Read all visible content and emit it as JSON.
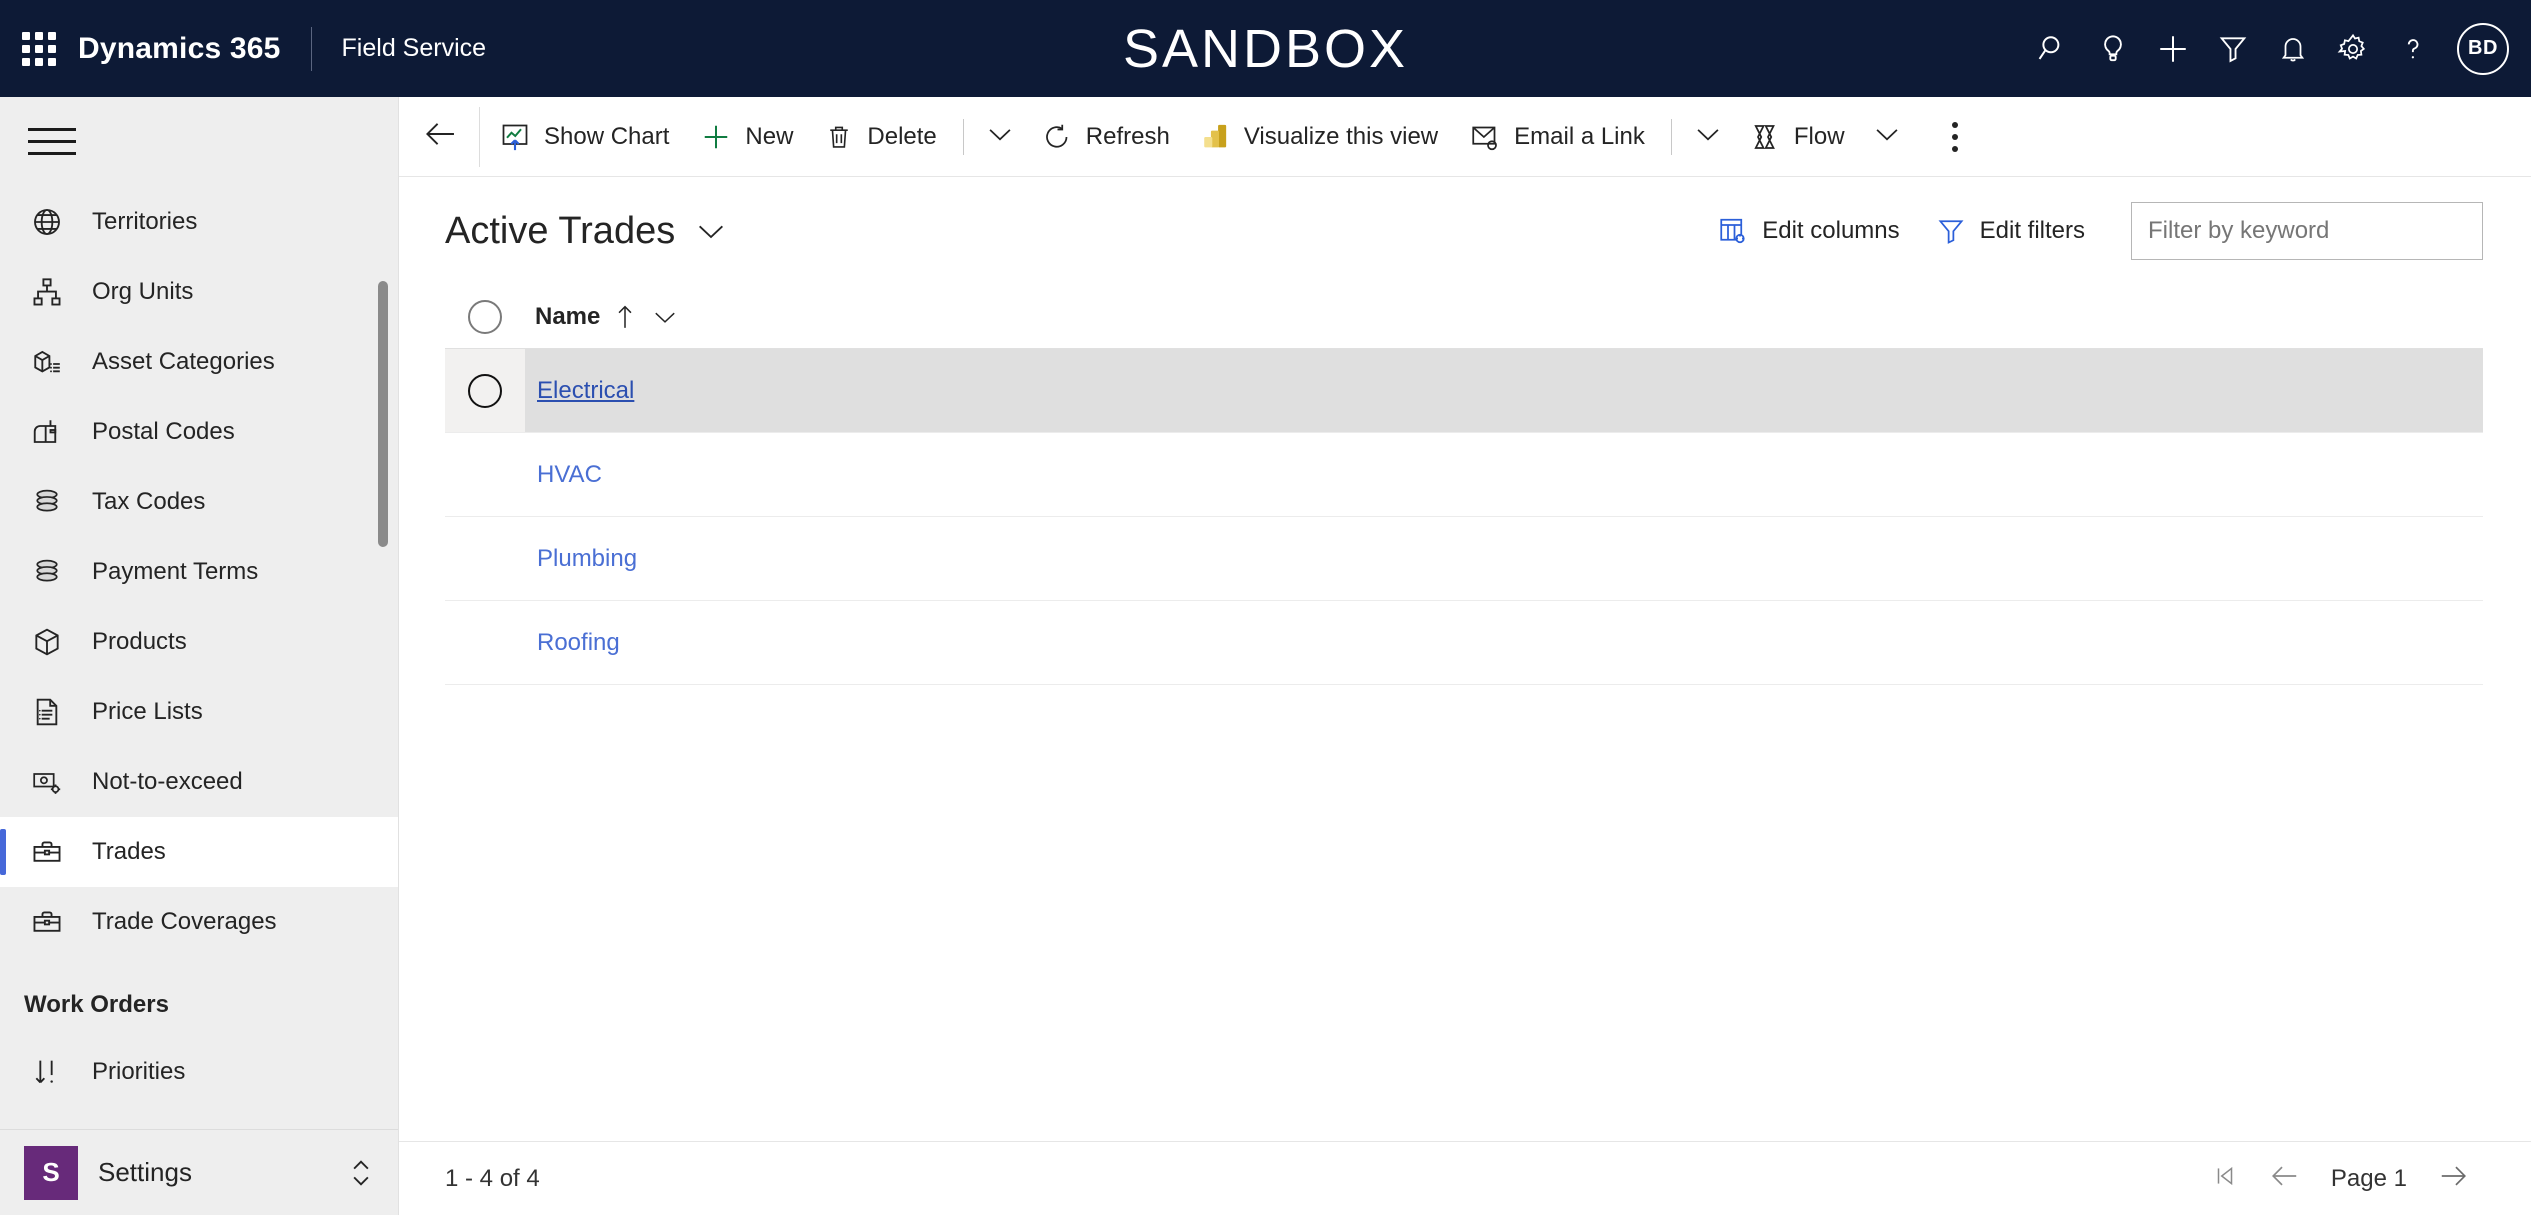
{
  "topbar": {
    "waffle_icon": "app-launcher-icon",
    "brand": "Dynamics 365",
    "app_name": "Field Service",
    "environment_banner": "SANDBOX",
    "actions": [
      {
        "name": "search-icon",
        "label": "Search"
      },
      {
        "name": "lightbulb-icon",
        "label": "Assist"
      },
      {
        "name": "plus-icon",
        "label": "Quick create"
      },
      {
        "name": "filter-icon",
        "label": "Filter"
      },
      {
        "name": "bell-icon",
        "label": "Notifications"
      },
      {
        "name": "gear-icon",
        "label": "Settings"
      },
      {
        "name": "question-icon",
        "label": "Help"
      }
    ],
    "avatar_initials": "BD"
  },
  "sidebar": {
    "hamburger_icon": "hamburger-icon",
    "items": [
      {
        "label": "Territories",
        "icon": "globe-icon",
        "selected": false
      },
      {
        "label": "Org Units",
        "icon": "org-chart-icon",
        "selected": false
      },
      {
        "label": "Asset Categories",
        "icon": "asset-box-icon",
        "selected": false
      },
      {
        "label": "Postal Codes",
        "icon": "mailbox-icon",
        "selected": false
      },
      {
        "label": "Tax Codes",
        "icon": "coins-icon",
        "selected": false
      },
      {
        "label": "Payment Terms",
        "icon": "coins-icon",
        "selected": false
      },
      {
        "label": "Products",
        "icon": "package-icon",
        "selected": false
      },
      {
        "label": "Price Lists",
        "icon": "price-list-icon",
        "selected": false
      },
      {
        "label": "Not-to-exceed",
        "icon": "money-gear-icon",
        "selected": false
      },
      {
        "label": "Trades",
        "icon": "toolbox-icon",
        "selected": true
      },
      {
        "label": "Trade Coverages",
        "icon": "toolbox-icon",
        "selected": false
      }
    ],
    "group_label": "Work Orders",
    "group_items": [
      {
        "label": "Priorities",
        "icon": "sort-priority-icon",
        "selected": false
      }
    ],
    "footer": {
      "badge": "S",
      "label": "Settings",
      "chevron_icon": "chevron-up-down-icon",
      "badge_color": "#672a7a"
    }
  },
  "commandbar": {
    "back_icon": "arrow-left-icon",
    "buttons": [
      {
        "label": "Show Chart",
        "icon": "show-chart-icon"
      },
      {
        "label": "New",
        "icon": "plus-green-icon"
      },
      {
        "label": "Delete",
        "icon": "trash-icon"
      }
    ],
    "delete_caret_icon": "chevron-down-icon",
    "buttons2": [
      {
        "label": "Refresh",
        "icon": "refresh-icon"
      },
      {
        "label": "Visualize this view",
        "icon": "powerbi-bars-icon"
      },
      {
        "label": "Email a Link",
        "icon": "email-link-icon"
      }
    ],
    "email_caret_icon": "chevron-down-icon",
    "flow": {
      "label": "Flow",
      "icon": "flow-icon",
      "caret_icon": "chevron-down-icon"
    },
    "overflow_icon": "more-vertical-icon"
  },
  "view": {
    "title": "Active Trades",
    "title_chevron_icon": "chevron-down-icon",
    "edit_columns": {
      "label": "Edit columns",
      "icon": "edit-columns-icon"
    },
    "edit_filters": {
      "label": "Edit filters",
      "icon": "funnel-icon"
    },
    "search_placeholder": "Filter by keyword",
    "search_value": ""
  },
  "grid": {
    "select_all_icon": "select-all-radio",
    "columns": [
      {
        "label": "Name",
        "sort": "asc",
        "sort_icon": "arrow-up-icon",
        "menu_icon": "chevron-down-icon"
      }
    ],
    "rows": [
      {
        "name": "Electrical",
        "selected": true,
        "active": true
      },
      {
        "name": "HVAC",
        "selected": false,
        "active": false
      },
      {
        "name": "Plumbing",
        "selected": false,
        "active": false
      },
      {
        "name": "Roofing",
        "selected": false,
        "active": false
      }
    ]
  },
  "footer": {
    "count": "1 - 4 of 4",
    "first_page_icon": "page-first-icon",
    "prev_page_icon": "arrow-left-icon",
    "page_label": "Page 1",
    "next_page_icon": "arrow-right-icon"
  },
  "colors": {
    "topbar_bg": "#0d1a36",
    "sidebar_bg": "#eeeeee",
    "accent_blue": "#4668d9",
    "link_blue": "#4a6fd4",
    "link_active": "#2b4fb0",
    "selected_row": "#dfdfdf",
    "settings_purple": "#672a7a",
    "powerbi_gold": "#c8a11c",
    "new_green": "#107c41"
  }
}
